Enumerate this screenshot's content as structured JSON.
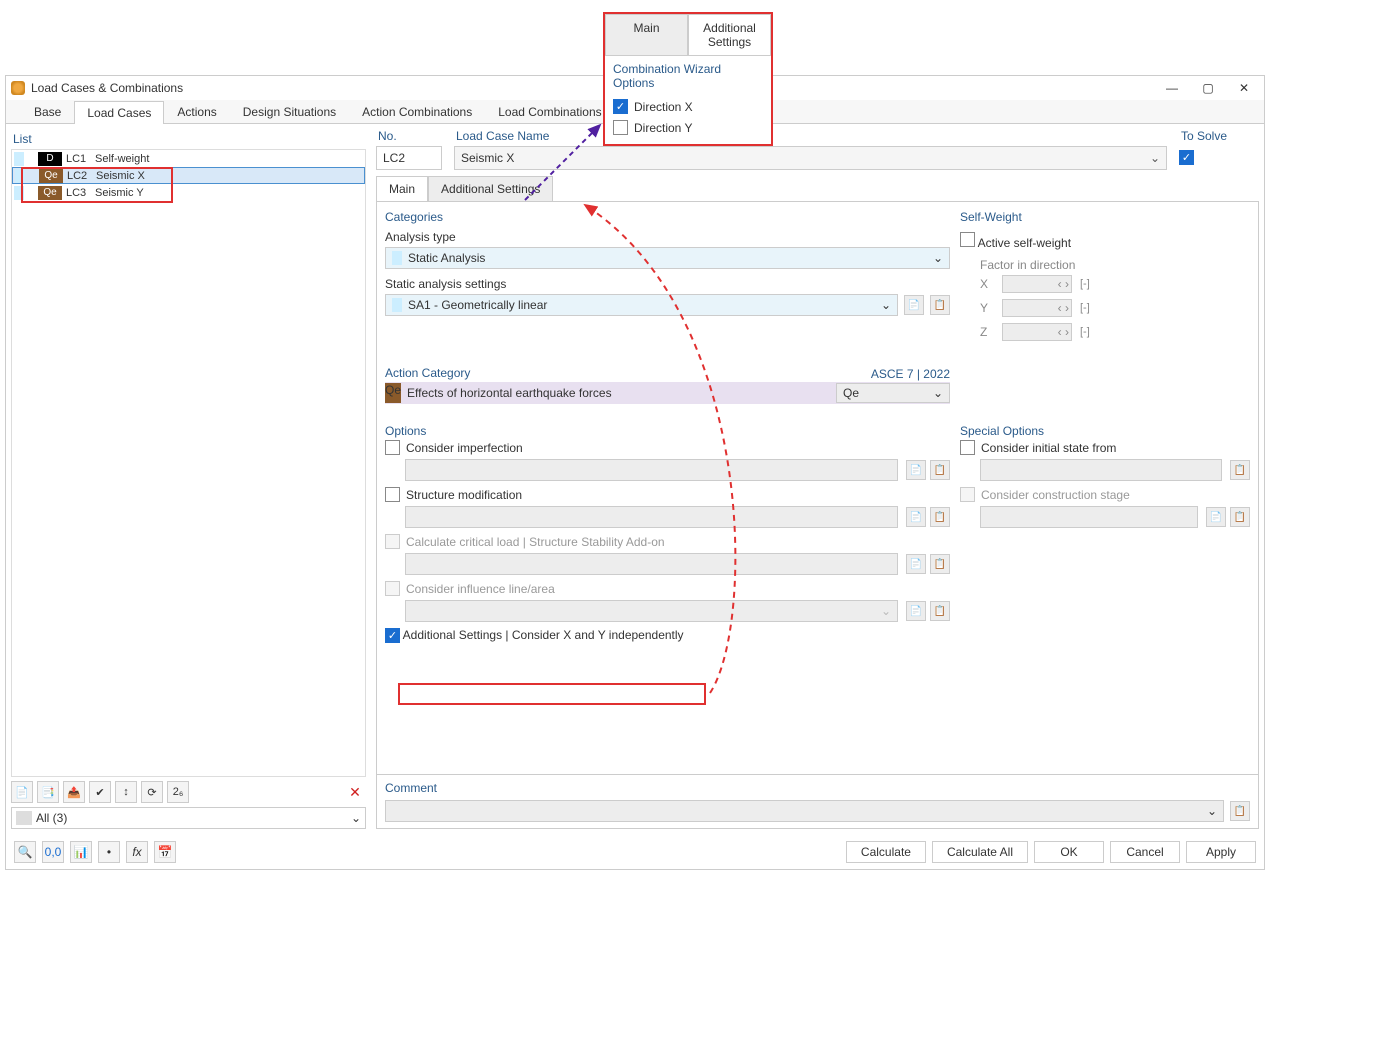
{
  "window": {
    "title": "Load Cases & Combinations"
  },
  "mainTabs": {
    "t0": "Base",
    "t1": "Load Cases",
    "t2": "Actions",
    "t3": "Design Situations",
    "t4": "Action Combinations",
    "t5": "Load Combinations"
  },
  "list": {
    "title": "List",
    "filter": "All (3)",
    "rows": {
      "r0": {
        "badge": "D",
        "code": "LC1",
        "name": "Self-weight"
      },
      "r1": {
        "badge": "Qe",
        "code": "LC2",
        "name": "Seismic X"
      },
      "r2": {
        "badge": "Qe",
        "code": "LC3",
        "name": "Seismic Y"
      }
    }
  },
  "fields": {
    "noLabel": "No.",
    "noVal": "LC2",
    "nameLabel": "Load Case Name",
    "nameVal": "Seismic X",
    "solveLabel": "To Solve"
  },
  "subTabs": {
    "main": "Main",
    "add": "Additional Settings"
  },
  "sections": {
    "categories": "Categories",
    "analysisType": "Analysis type",
    "analysisTypeVal": "Static Analysis",
    "sas": "Static analysis settings",
    "sasVal": "SA1 - Geometrically linear",
    "actionCategory": "Action Category",
    "standard": "ASCE 7 | 2022",
    "acBadge": "Qe",
    "acText": "Effects of horizontal earthquake forces",
    "acCode": "Qe",
    "options": "Options",
    "opt1": "Consider imperfection",
    "opt2": "Structure modification",
    "opt3": "Calculate critical load | Structure Stability Add-on",
    "opt4": "Consider influence line/area",
    "opt5": "Additional Settings | Consider X and Y independently",
    "selfWeight": "Self-Weight",
    "activeSelfWeight": "Active self-weight",
    "factorDir": "Factor in direction",
    "special": "Special Options",
    "sopt1": "Consider initial state from",
    "sopt2": "Consider construction stage",
    "comment": "Comment",
    "unit": "[-]"
  },
  "axes": {
    "x": "X",
    "y": "Y",
    "z": "Z"
  },
  "footer": {
    "calculate": "Calculate",
    "calculateAll": "Calculate All",
    "ok": "OK",
    "cancel": "Cancel",
    "apply": "Apply"
  },
  "popup": {
    "t1": "Main",
    "t2": "Additional Settings",
    "title": "Combination Wizard Options",
    "c1": "Direction X",
    "c2": "Direction Y"
  }
}
